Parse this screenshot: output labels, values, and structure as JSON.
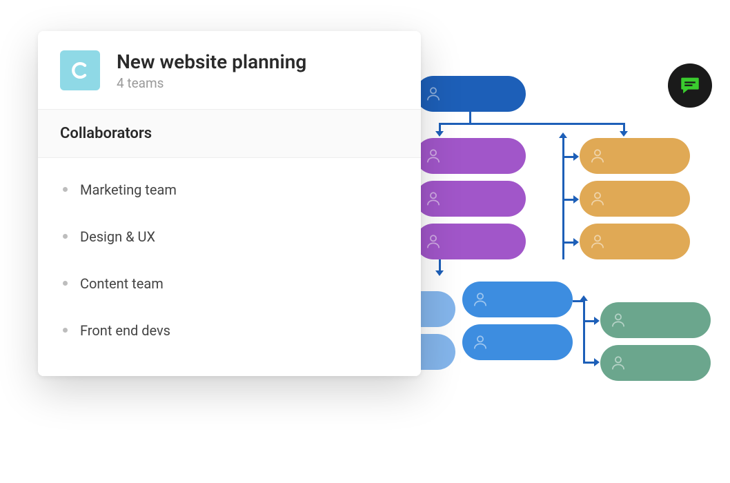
{
  "card": {
    "title": "New website planning",
    "subtitle": "4 teams",
    "logo_letter": "c"
  },
  "section": {
    "header": "Collaborators",
    "items": [
      {
        "label": "Marketing team"
      },
      {
        "label": "Design & UX"
      },
      {
        "label": "Content team"
      },
      {
        "label": "Front end devs"
      }
    ]
  },
  "chat": {
    "icon": "chat-icon"
  },
  "colors": {
    "darkblue": "#1d5fb8",
    "purple": "#a156c9",
    "orange": "#e0a955",
    "blue": "#3d8de0",
    "lightblue": "#6fa8e8",
    "green": "#6ba68d",
    "logo_bg": "#8fd9e6"
  }
}
